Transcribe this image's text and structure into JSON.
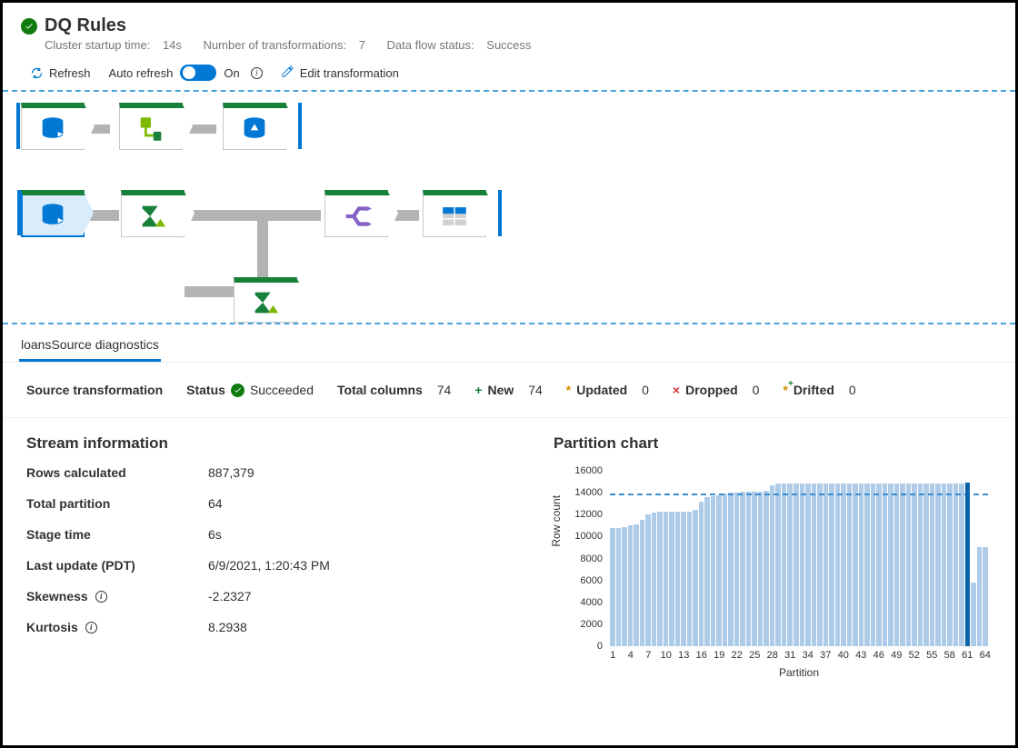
{
  "header": {
    "title": "DQ Rules",
    "cluster_label": "Cluster startup time:",
    "cluster_value": "14s",
    "tx_label": "Number of transformations:",
    "tx_value": "7",
    "flow_label": "Data flow status:",
    "flow_value": "Success"
  },
  "toolbar": {
    "refresh": "Refresh",
    "auto_refresh": "Auto refresh",
    "toggle_state": "On",
    "edit": "Edit transformation"
  },
  "tabs": {
    "active": "loansSource diagnostics"
  },
  "strip": {
    "source_label": "Source transformation",
    "status_label": "Status",
    "status_value": "Succeeded",
    "totcols_label": "Total columns",
    "totcols_value": "74",
    "new_label": "New",
    "new_value": "74",
    "upd_label": "Updated",
    "upd_value": "0",
    "drop_label": "Dropped",
    "drop_value": "0",
    "drift_label": "Drifted",
    "drift_value": "0"
  },
  "stream": {
    "heading": "Stream information",
    "rows_k": "Rows calculated",
    "rows_v": "887,379",
    "part_k": "Total partition",
    "part_v": "64",
    "stage_k": "Stage time",
    "stage_v": "6s",
    "upd_k": "Last update (PDT)",
    "upd_v": "6/9/2021, 1:20:43 PM",
    "skew_k": "Skewness",
    "skew_v": "-2.2327",
    "kurt_k": "Kurtosis",
    "kurt_v": "8.2938"
  },
  "chart_data": {
    "type": "bar",
    "title": "Partition chart",
    "xlabel": "Partition",
    "ylabel": "Row count",
    "ylim": [
      0,
      16000
    ],
    "yticks": [
      0,
      2000,
      4000,
      6000,
      8000,
      10000,
      12000,
      14000,
      16000
    ],
    "xticks": [
      1,
      4,
      7,
      10,
      13,
      16,
      19,
      22,
      25,
      28,
      31,
      34,
      37,
      40,
      43,
      46,
      49,
      52,
      55,
      58,
      61,
      64
    ],
    "average": 13800,
    "highlight_index": 61,
    "values": [
      10800,
      10800,
      10900,
      11000,
      11100,
      11500,
      12000,
      12200,
      12300,
      12300,
      12300,
      12300,
      12300,
      12300,
      12400,
      13200,
      13600,
      13700,
      13800,
      13900,
      14000,
      14000,
      14100,
      14100,
      14100,
      14100,
      14200,
      14700,
      14800,
      14800,
      14800,
      14800,
      14800,
      14800,
      14800,
      14800,
      14800,
      14800,
      14800,
      14800,
      14800,
      14800,
      14800,
      14800,
      14800,
      14800,
      14800,
      14800,
      14800,
      14800,
      14800,
      14800,
      14800,
      14800,
      14800,
      14800,
      14800,
      14800,
      14800,
      14800,
      14900,
      5800,
      9000,
      9000
    ]
  }
}
